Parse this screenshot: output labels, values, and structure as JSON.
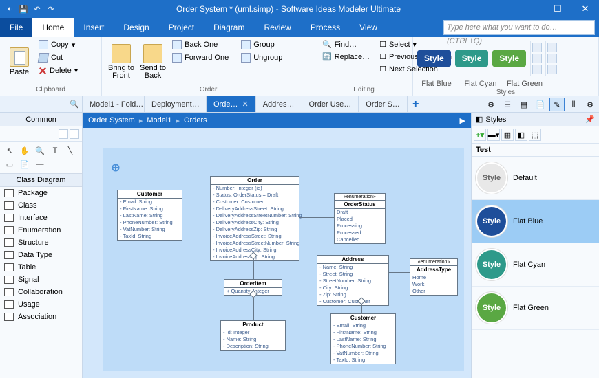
{
  "title": "Order System * (uml.simp)  - Software Ideas Modeler Ultimate",
  "search_placeholder": "Type here what you want to do…   (CTRL+Q)",
  "menu": {
    "file": "File",
    "home": "Home",
    "insert": "Insert",
    "design": "Design",
    "project": "Project",
    "diagram": "Diagram",
    "review": "Review",
    "process": "Process",
    "view": "View"
  },
  "ribbon": {
    "clipboard": {
      "paste": "Paste",
      "copy": "Copy",
      "cut": "Cut",
      "delete": "Delete",
      "label": "Clipboard"
    },
    "order": {
      "bring_front": "Bring to\nFront",
      "send_back": "Send to\nBack",
      "back_one": "Back One",
      "forward_one": "Forward One",
      "group": "Group",
      "ungroup": "Ungroup",
      "label": "Order"
    },
    "editing": {
      "find": "Find…",
      "replace": "Replace…",
      "select": "Select",
      "prev_sel": "Previous Selection",
      "next_sel": "Next Selection",
      "label": "Editing"
    },
    "styles": {
      "style": "Style",
      "flat_blue": "Flat Blue",
      "flat_cyan": "Flat Cyan",
      "flat_green": "Flat Green",
      "label": "Styles"
    }
  },
  "tabs": [
    "Model1 - Fold…",
    "Deployment…",
    "Orde…",
    "Addres…",
    "Order Use…",
    "Order S…"
  ],
  "breadcrumb": [
    "Order System",
    "Model1",
    "Orders"
  ],
  "left": {
    "common": "Common",
    "class_diagram": "Class Diagram",
    "items": [
      "Package",
      "Class",
      "Interface",
      "Enumeration",
      "Structure",
      "Data Type",
      "Table",
      "Signal",
      "Collaboration",
      "Usage",
      "Association"
    ]
  },
  "boxes": {
    "customer": {
      "title": "Customer",
      "rows": [
        "- Email: String",
        "- FirstName: String",
        "- LastName: String",
        "- PhoneNumber: String",
        "- VatNumber: String",
        "- TaxId: String"
      ]
    },
    "order": {
      "title": "Order",
      "rows": [
        "- Number: Integer {id}",
        "- Status: OrderStatus = Draft",
        "- Customer: Customer",
        "- DeliveryAddressStreet: String",
        "- DeliveryAddressStreetNumber: String",
        "- DeliveryAddressCity: String",
        "- DeliveryAddressZip: String",
        "- InvoiceAddressStreet: String",
        "- InvoiceAddressStreetNumber: String",
        "- InvoiceAddressCity: String",
        "- InvoiceAddressZip: String"
      ]
    },
    "orderstatus": {
      "stereo": "«enumeration»",
      "title": "OrderStatus",
      "rows": [
        "Draft",
        "Placed",
        "Processing",
        "Processed",
        "Cancelled"
      ]
    },
    "orderitem": {
      "title": "OrderItem",
      "rows": [
        "+ Quantity: Integer"
      ]
    },
    "product": {
      "title": "Product",
      "rows": [
        "- Id: Integer",
        "- Name: String",
        "- Description: String"
      ]
    },
    "address": {
      "title": "Address",
      "rows": [
        "- Name: String",
        "- Street: String",
        "- StreetNumber: String",
        "- City: String",
        "- Zip: String",
        "- Customer: Customer"
      ]
    },
    "addresstype": {
      "stereo": "«enumeration»",
      "title": "AddressType",
      "rows": [
        "Home",
        "Work",
        "Other"
      ]
    },
    "customer2": {
      "title": "Customer",
      "rows": [
        "- Email: String",
        "- FirstName: String",
        "- LastName: String",
        "- PhoneNumber: String",
        "- VatNumber: String",
        "- TaxId: String"
      ]
    }
  },
  "right": {
    "header": "Styles",
    "test": "Test",
    "items": [
      {
        "name": "Default",
        "color": "#e8e8e8",
        "text": "#666"
      },
      {
        "name": "Flat Blue",
        "color": "#1e4e9a",
        "text": "#fff"
      },
      {
        "name": "Flat Cyan",
        "color": "#2e9a8a",
        "text": "#fff"
      },
      {
        "name": "Flat Green",
        "color": "#5aa843",
        "text": "#fff"
      }
    ]
  },
  "colors": {
    "blue": "#1e4e9a",
    "cyan": "#2e9a8a",
    "green": "#5aa843"
  }
}
